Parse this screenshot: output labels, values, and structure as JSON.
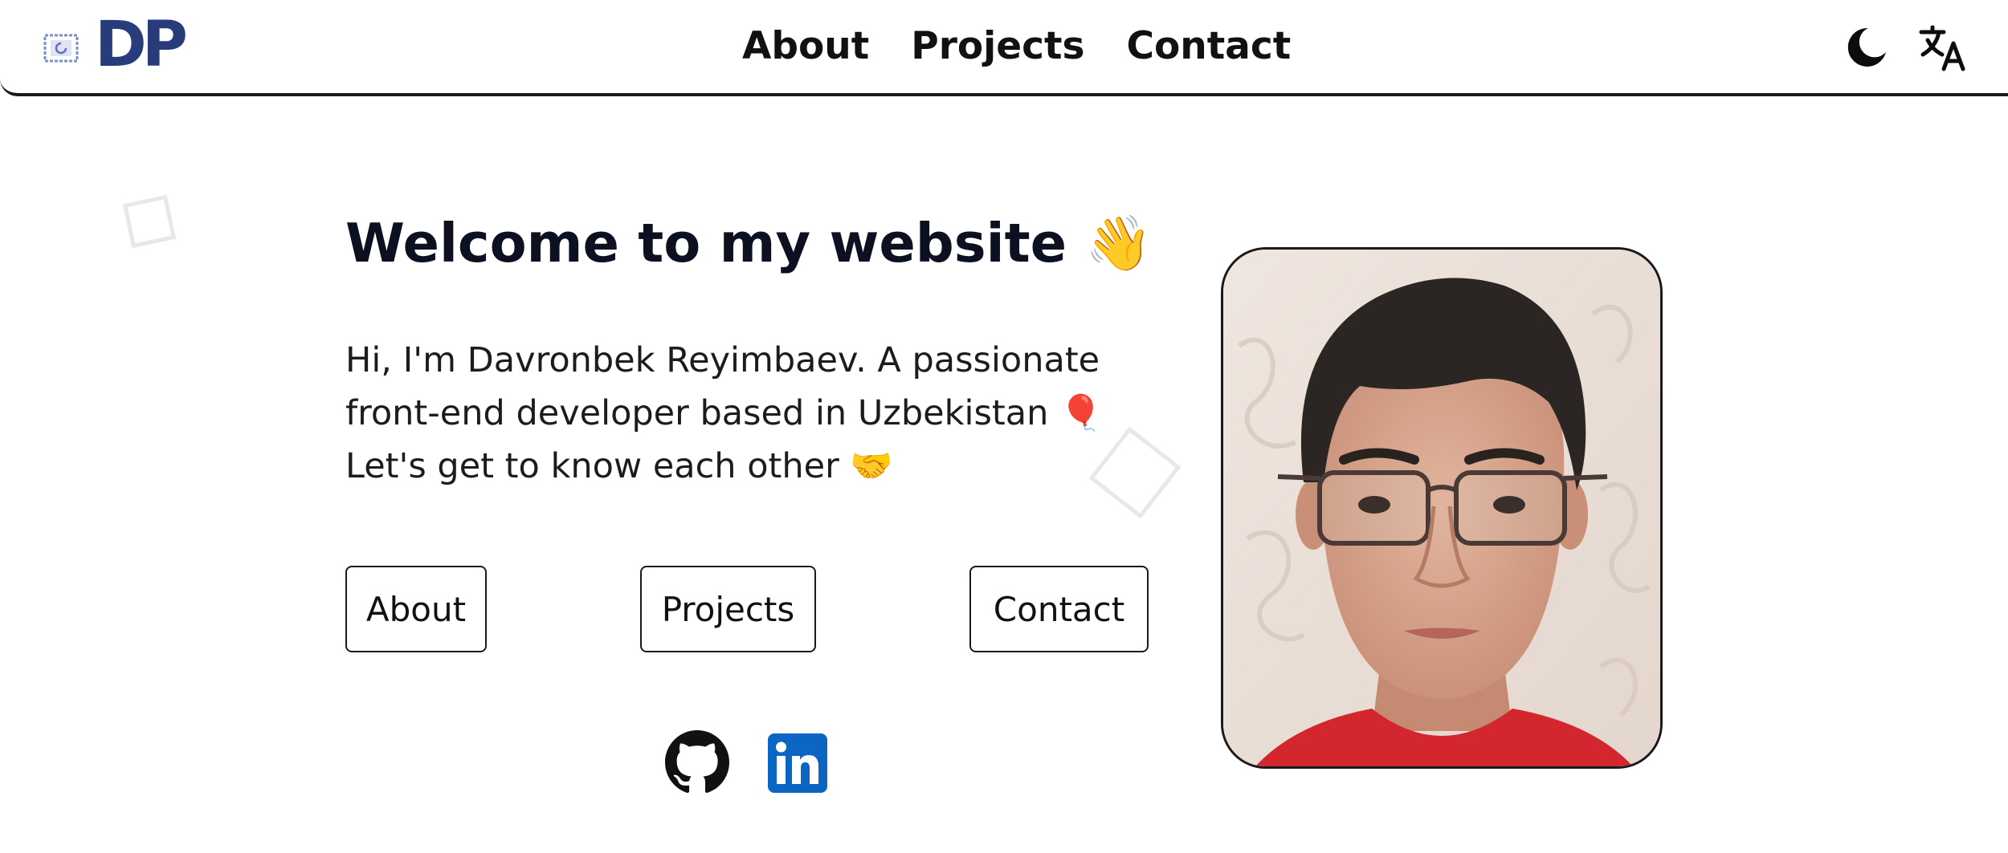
{
  "header": {
    "logo_text": "DP",
    "nav": [
      {
        "label": "About"
      },
      {
        "label": "Projects"
      },
      {
        "label": "Contact"
      }
    ],
    "theme_toggle_icon": "moon-icon",
    "language_toggle_icon": "translate-icon"
  },
  "hero": {
    "title": "Welcome to my website 👋",
    "description_lines": [
      "Hi, I'm Davronbek Reyimbaev. A passionate",
      "front-end developer based in Uzbekistan 🎈",
      "Let's get to know each other 🤝"
    ],
    "buttons": [
      {
        "label": "About"
      },
      {
        "label": "Projects"
      },
      {
        "label": "Contact"
      }
    ],
    "social": [
      {
        "icon": "github-icon"
      },
      {
        "icon": "linkedin-icon"
      }
    ]
  },
  "portrait": {
    "icon": "profile-photo"
  },
  "colors": {
    "logo": "#283b7a",
    "text": "#0d1020",
    "border": "#1a1a1a",
    "linkedin": "#0a66c2",
    "background": "#ffffff"
  }
}
